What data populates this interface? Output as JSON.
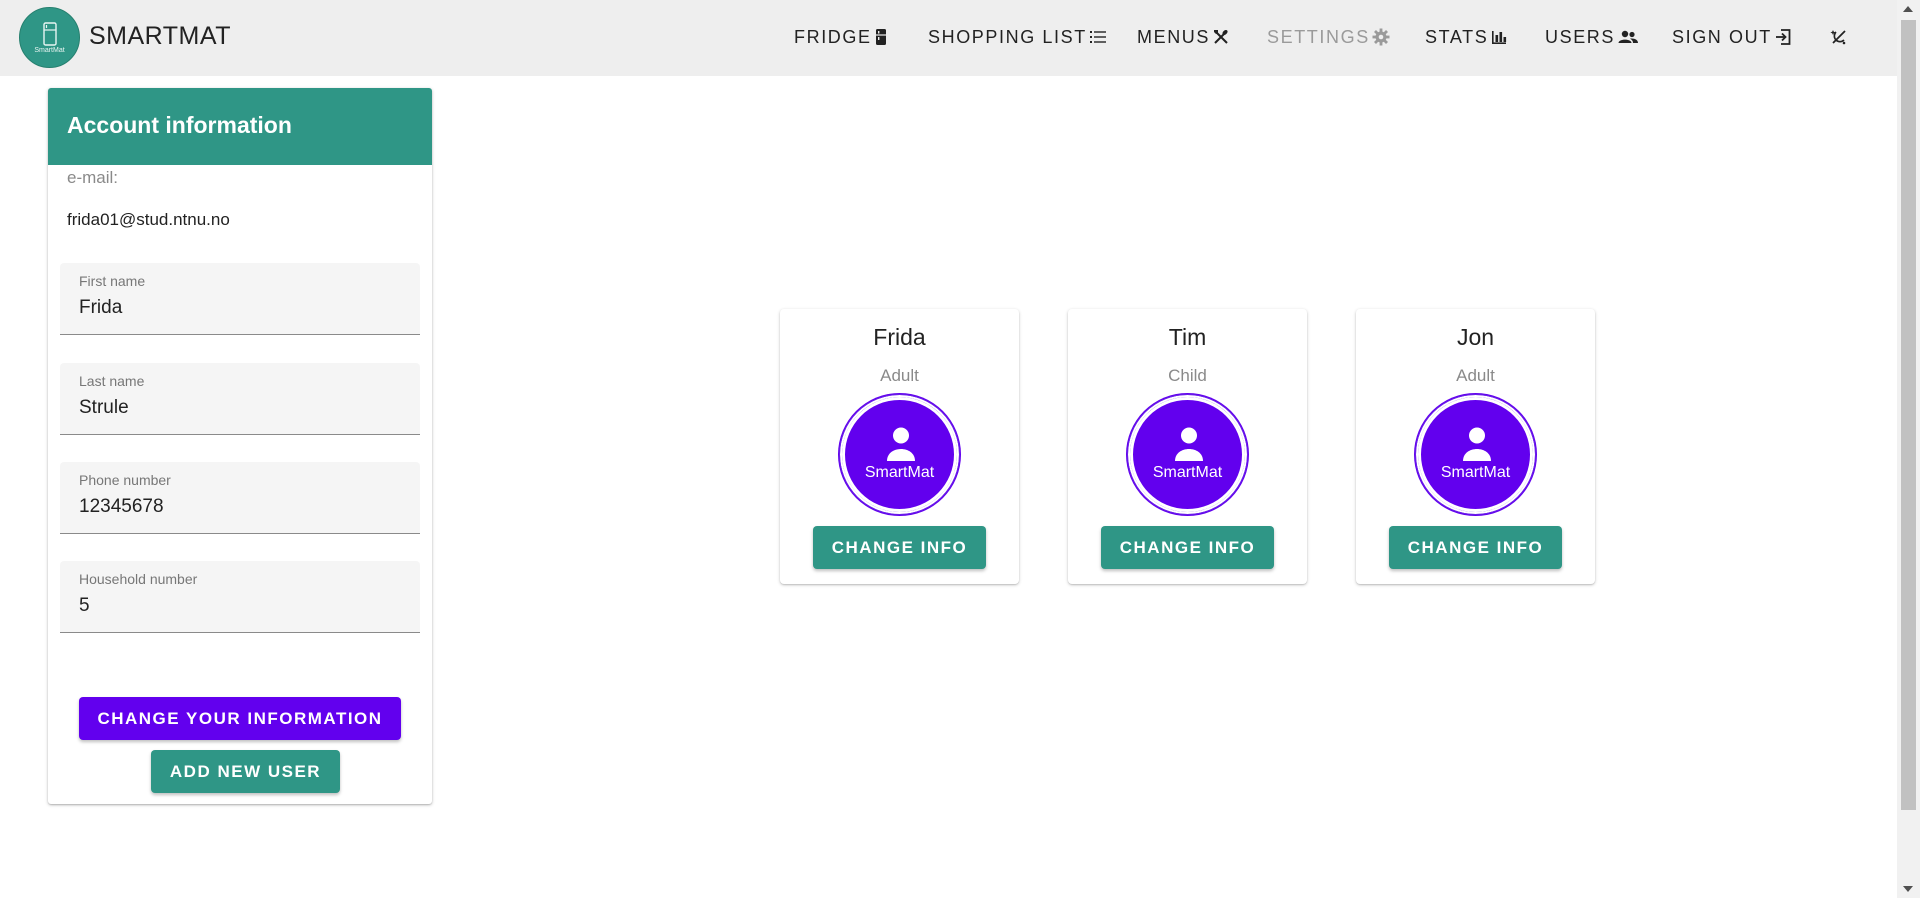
{
  "app": {
    "brand": "SMARTMAT",
    "logo_text": "SmartMat"
  },
  "nav": {
    "fridge": "FRIDGE",
    "shopping_list": "SHOPPING LIST",
    "menus": "MENUS",
    "settings": "SETTINGS",
    "stats": "STATS",
    "users": "USERS",
    "sign_out": "SIGN OUT",
    "active": "settings"
  },
  "account": {
    "title": "Account information",
    "email_label": "e-mail:",
    "email_value": "frida01@stud.ntnu.no",
    "fields": [
      {
        "label": "First name",
        "value": "Frida"
      },
      {
        "label": "Last name",
        "value": "Strule"
      },
      {
        "label": "Phone number",
        "value": "12345678"
      },
      {
        "label": "Household number",
        "value": "5"
      }
    ],
    "change_button": "CHANGE YOUR INFORMATION",
    "add_user_button": "ADD NEW USER"
  },
  "users": [
    {
      "name": "Frida",
      "role": "Adult",
      "avatar_text": "SmartMat",
      "button": "CHANGE INFO"
    },
    {
      "name": "Tim",
      "role": "Child",
      "avatar_text": "SmartMat",
      "button": "CHANGE INFO"
    },
    {
      "name": "Jon",
      "role": "Adult",
      "avatar_text": "SmartMat",
      "button": "CHANGE INFO"
    }
  ],
  "colors": {
    "primary_teal": "#2f9686",
    "accent_purple": "#6200ee",
    "topbar": "#eeeeee"
  },
  "icons": [
    "fridge-icon",
    "list-icon",
    "utensils-icon",
    "gear-icon",
    "bar-chart-icon",
    "users-icon",
    "sign-out-icon",
    "theme-toggle-icon"
  ]
}
